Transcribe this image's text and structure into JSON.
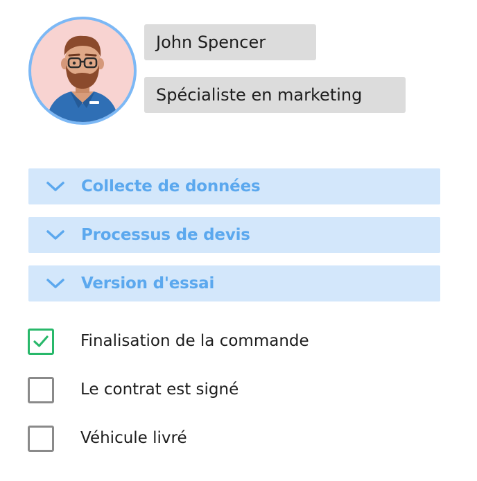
{
  "profile": {
    "name": "John Spencer",
    "role": "Spécialiste en marketing",
    "avatar_icon": "person-avatar-icon",
    "avatar_bg": "#f8d3d1",
    "avatar_ring": "#7cb8f5"
  },
  "sections": [
    {
      "label": "Collecte de données",
      "icon": "chevron-down-icon"
    },
    {
      "label": "Processus de devis",
      "icon": "chevron-down-icon"
    },
    {
      "label": "Version d'essai",
      "icon": "chevron-down-icon"
    }
  ],
  "checklist": [
    {
      "label": "Finalisation de la commande",
      "checked": true
    },
    {
      "label": "Le contrat est signé",
      "checked": false
    },
    {
      "label": "Véhicule livré",
      "checked": false
    }
  ],
  "colors": {
    "accent": "#5ba8ee",
    "section_bg": "#d3e7fb",
    "pill_bg": "#dcdcdc",
    "check_green": "#28b86a",
    "check_border": "#8a8a8a"
  }
}
